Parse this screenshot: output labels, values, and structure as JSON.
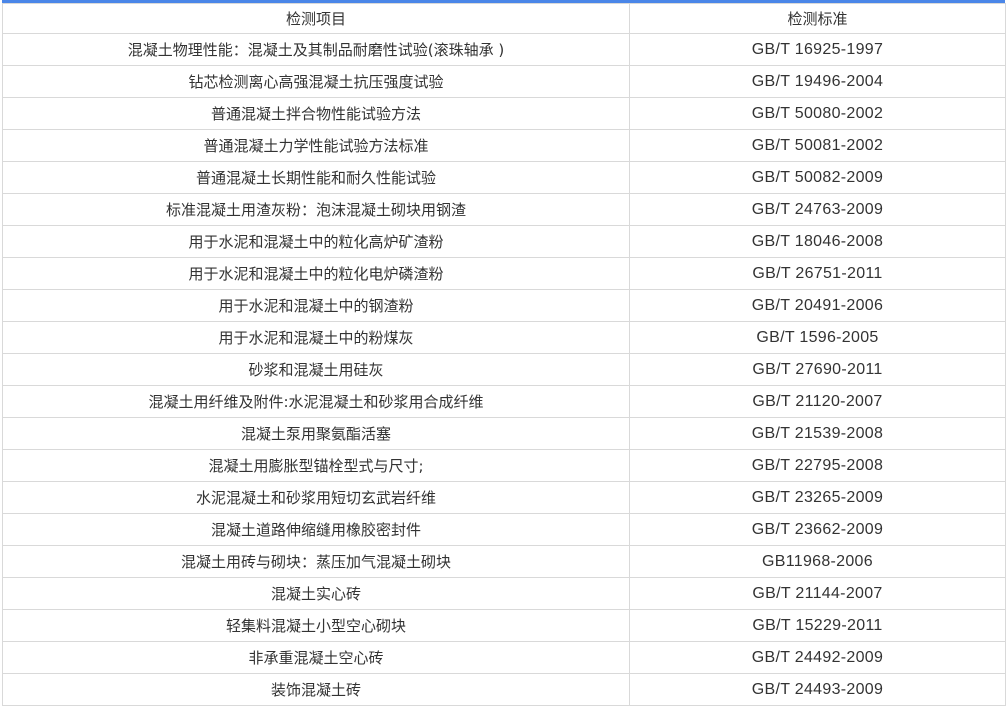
{
  "table": {
    "headers": [
      "检测项目",
      "检测标准"
    ],
    "rows": [
      [
        "混凝土物理性能：混凝土及其制品耐磨性试验(滚珠轴承 )",
        "GB/T 16925-1997"
      ],
      [
        "钻芯检测离心高强混凝土抗压强度试验",
        "GB/T 19496-2004"
      ],
      [
        "普通混凝土拌合物性能试验方法",
        "GB/T 50080-2002"
      ],
      [
        "普通混凝土力学性能试验方法标准",
        "GB/T 50081-2002"
      ],
      [
        "普通混凝土长期性能和耐久性能试验",
        "GB/T 50082-2009"
      ],
      [
        "标准混凝土用渣灰粉：泡沫混凝土砌块用钢渣",
        "GB/T 24763-2009"
      ],
      [
        "用于水泥和混凝土中的粒化高炉矿渣粉",
        "GB/T 18046-2008"
      ],
      [
        "用于水泥和混凝土中的粒化电炉磷渣粉",
        "GB/T 26751-2011"
      ],
      [
        "用于水泥和混凝土中的钢渣粉",
        "GB/T 20491-2006"
      ],
      [
        "用于水泥和混凝土中的粉煤灰",
        "GB/T 1596-2005"
      ],
      [
        "砂浆和混凝土用硅灰",
        "GB/T 27690-2011"
      ],
      [
        "混凝土用纤维及附件:水泥混凝土和砂浆用合成纤维",
        "GB/T 21120-2007"
      ],
      [
        "混凝土泵用聚氨酯活塞",
        "GB/T 21539-2008"
      ],
      [
        "混凝土用膨胀型锚栓型式与尺寸;",
        "GB/T 22795-2008"
      ],
      [
        "水泥混凝土和砂浆用短切玄武岩纤维",
        "GB/T 23265-2009"
      ],
      [
        "混凝土道路伸缩缝用橡胶密封件",
        "GB/T 23662-2009"
      ],
      [
        "混凝土用砖与砌块：蒸压加气混凝土砌块",
        "GB11968-2006"
      ],
      [
        "混凝土实心砖",
        "GB/T 21144-2007"
      ],
      [
        "轻集料混凝土小型空心砌块",
        "GB/T 15229-2011"
      ],
      [
        "非承重混凝土空心砖",
        "GB/T 24492-2009"
      ],
      [
        "装饰混凝土砖",
        "GB/T 24493-2009"
      ]
    ]
  }
}
